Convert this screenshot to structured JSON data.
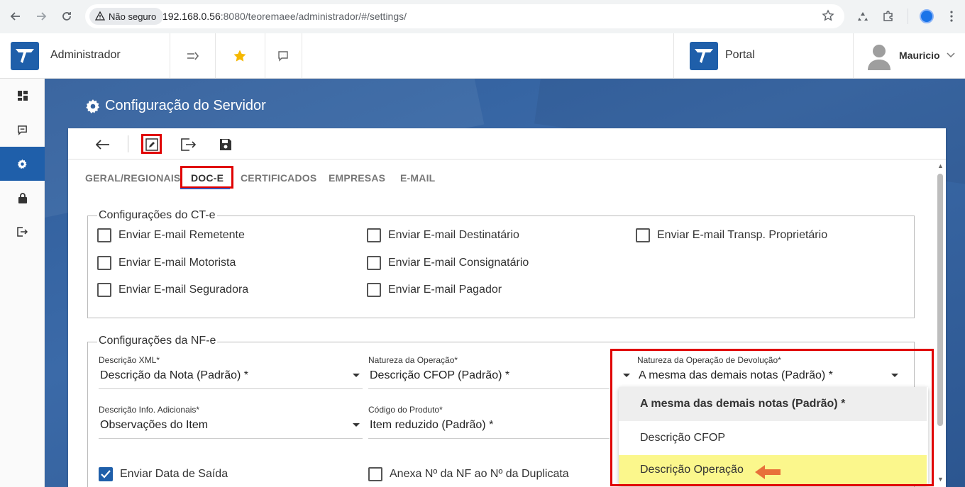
{
  "browser": {
    "security_label": "Não seguro",
    "url_host": "192.168.0.56",
    "url_rest": ":8080/teoremaee/administrador/#/settings/"
  },
  "header": {
    "app_title": "Administrador",
    "portal_title": "Portal",
    "user_name": "Mauricio"
  },
  "page": {
    "title": "Configuração do Servidor"
  },
  "tabs": [
    {
      "label": "GERAL/REGIONAIS"
    },
    {
      "label": "DOC-E"
    },
    {
      "label": "CERTIFICADOS"
    },
    {
      "label": "EMPRESAS"
    },
    {
      "label": "E-MAIL"
    }
  ],
  "cte": {
    "legend": "Configurações do CT-e",
    "checkboxes": [
      {
        "label": "Enviar E-mail Remetente",
        "checked": false
      },
      {
        "label": "Enviar E-mail Destinatário",
        "checked": false
      },
      {
        "label": "Enviar E-mail Transp. Proprietário",
        "checked": false
      },
      {
        "label": "Enviar E-mail Motorista",
        "checked": false
      },
      {
        "label": "Enviar E-mail Consignatário",
        "checked": false
      },
      {
        "label": "Enviar E-mail Seguradora",
        "checked": false
      },
      {
        "label": "Enviar E-mail Pagador",
        "checked": false
      }
    ]
  },
  "nfe": {
    "legend": "Configurações da NF-e",
    "fields": [
      {
        "label": "Descrição XML*",
        "value": "Descrição da Nota (Padrão) *"
      },
      {
        "label": "Natureza da Operação*",
        "value": "Descrição CFOP (Padrão) *"
      },
      {
        "label": "Natureza da Operação de Devolução*",
        "value": "A mesma das demais notas (Padrão) *"
      },
      {
        "label": "Descrição Info. Adicionais*",
        "value": "Observações do Item"
      },
      {
        "label": "Código do Produto*",
        "value": "Item reduzido (Padrão) *"
      }
    ],
    "checkboxes": [
      {
        "label": "Enviar Data de Saída",
        "checked": true
      },
      {
        "label": "Anexa Nº da NF ao Nº da Duplicata",
        "checked": false
      }
    ]
  },
  "dropdown": {
    "options": [
      {
        "label": "A mesma das demais notas (Padrão) *",
        "state": "selected"
      },
      {
        "label": "Descrição CFOP",
        "state": "normal"
      },
      {
        "label": "Descrição Operação",
        "state": "highlighted"
      }
    ]
  },
  "colors": {
    "brand": "#1f5faa",
    "annotation_red": "#e00000",
    "highlight": "#fbf78c",
    "arrow": "#e8703a"
  }
}
